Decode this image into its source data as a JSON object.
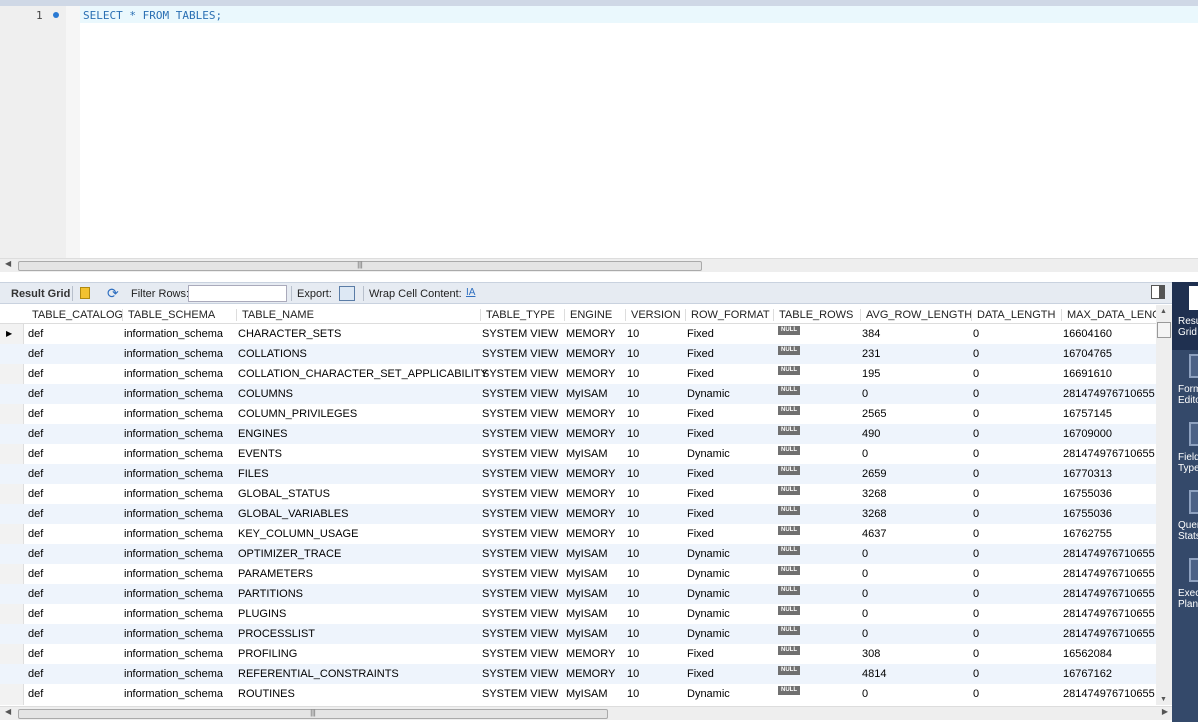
{
  "editor": {
    "line_number": "1",
    "sql": "SELECT * FROM TABLES;"
  },
  "result_toolbar": {
    "result_grid": "Result Grid",
    "filter_rows": "Filter Rows:",
    "filter_value": "",
    "export": "Export:",
    "wrap_cell": "Wrap Cell Content:"
  },
  "side_panel": [
    {
      "label": "Result Grid"
    },
    {
      "label": "Form Editor"
    },
    {
      "label": "Field Types"
    },
    {
      "label": "Query Stats"
    },
    {
      "label": "Execution Plan"
    }
  ],
  "columns": [
    "TABLE_CATALOG",
    "TABLE_SCHEMA",
    "TABLE_NAME",
    "TABLE_TYPE",
    "ENGINE",
    "VERSION",
    "ROW_FORMAT",
    "TABLE_ROWS",
    "AVG_ROW_LENGTH",
    "DATA_LENGTH",
    "MAX_DATA_LENGTH"
  ],
  "null_label": "NULL",
  "rows": [
    [
      "def",
      "information_schema",
      "CHARACTER_SETS",
      "SYSTEM VIEW",
      "MEMORY",
      "10",
      "Fixed",
      null,
      "384",
      "0",
      "16604160"
    ],
    [
      "def",
      "information_schema",
      "COLLATIONS",
      "SYSTEM VIEW",
      "MEMORY",
      "10",
      "Fixed",
      null,
      "231",
      "0",
      "16704765"
    ],
    [
      "def",
      "information_schema",
      "COLLATION_CHARACTER_SET_APPLICABILITY",
      "SYSTEM VIEW",
      "MEMORY",
      "10",
      "Fixed",
      null,
      "195",
      "0",
      "16691610"
    ],
    [
      "def",
      "information_schema",
      "COLUMNS",
      "SYSTEM VIEW",
      "MyISAM",
      "10",
      "Dynamic",
      null,
      "0",
      "0",
      "281474976710655"
    ],
    [
      "def",
      "information_schema",
      "COLUMN_PRIVILEGES",
      "SYSTEM VIEW",
      "MEMORY",
      "10",
      "Fixed",
      null,
      "2565",
      "0",
      "16757145"
    ],
    [
      "def",
      "information_schema",
      "ENGINES",
      "SYSTEM VIEW",
      "MEMORY",
      "10",
      "Fixed",
      null,
      "490",
      "0",
      "16709000"
    ],
    [
      "def",
      "information_schema",
      "EVENTS",
      "SYSTEM VIEW",
      "MyISAM",
      "10",
      "Dynamic",
      null,
      "0",
      "0",
      "281474976710655"
    ],
    [
      "def",
      "information_schema",
      "FILES",
      "SYSTEM VIEW",
      "MEMORY",
      "10",
      "Fixed",
      null,
      "2659",
      "0",
      "16770313"
    ],
    [
      "def",
      "information_schema",
      "GLOBAL_STATUS",
      "SYSTEM VIEW",
      "MEMORY",
      "10",
      "Fixed",
      null,
      "3268",
      "0",
      "16755036"
    ],
    [
      "def",
      "information_schema",
      "GLOBAL_VARIABLES",
      "SYSTEM VIEW",
      "MEMORY",
      "10",
      "Fixed",
      null,
      "3268",
      "0",
      "16755036"
    ],
    [
      "def",
      "information_schema",
      "KEY_COLUMN_USAGE",
      "SYSTEM VIEW",
      "MEMORY",
      "10",
      "Fixed",
      null,
      "4637",
      "0",
      "16762755"
    ],
    [
      "def",
      "information_schema",
      "OPTIMIZER_TRACE",
      "SYSTEM VIEW",
      "MyISAM",
      "10",
      "Dynamic",
      null,
      "0",
      "0",
      "281474976710655"
    ],
    [
      "def",
      "information_schema",
      "PARAMETERS",
      "SYSTEM VIEW",
      "MyISAM",
      "10",
      "Dynamic",
      null,
      "0",
      "0",
      "281474976710655"
    ],
    [
      "def",
      "information_schema",
      "PARTITIONS",
      "SYSTEM VIEW",
      "MyISAM",
      "10",
      "Dynamic",
      null,
      "0",
      "0",
      "281474976710655"
    ],
    [
      "def",
      "information_schema",
      "PLUGINS",
      "SYSTEM VIEW",
      "MyISAM",
      "10",
      "Dynamic",
      null,
      "0",
      "0",
      "281474976710655"
    ],
    [
      "def",
      "information_schema",
      "PROCESSLIST",
      "SYSTEM VIEW",
      "MyISAM",
      "10",
      "Dynamic",
      null,
      "0",
      "0",
      "281474976710655"
    ],
    [
      "def",
      "information_schema",
      "PROFILING",
      "SYSTEM VIEW",
      "MEMORY",
      "10",
      "Fixed",
      null,
      "308",
      "0",
      "16562084"
    ],
    [
      "def",
      "information_schema",
      "REFERENTIAL_CONSTRAINTS",
      "SYSTEM VIEW",
      "MEMORY",
      "10",
      "Fixed",
      null,
      "4814",
      "0",
      "16767162"
    ],
    [
      "def",
      "information_schema",
      "ROUTINES",
      "SYSTEM VIEW",
      "MyISAM",
      "10",
      "Dynamic",
      null,
      "0",
      "0",
      "281474976710655"
    ]
  ]
}
